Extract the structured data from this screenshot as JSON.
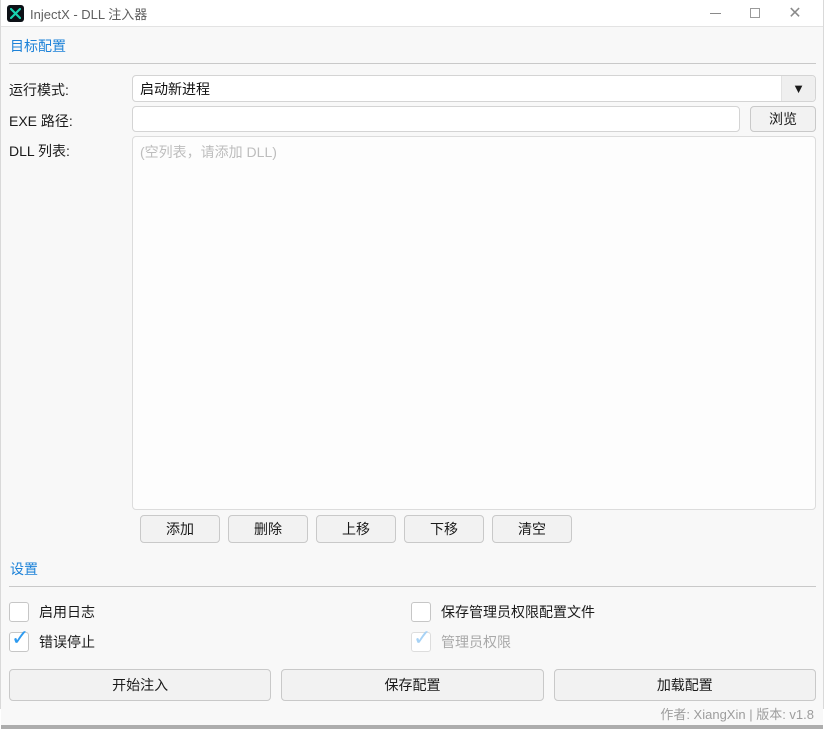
{
  "window": {
    "title": "InjectX - DLL 注入器",
    "icon": "injectx-logo-x",
    "accent_blue": "#1d82d8",
    "check_blue": "#2e9bf0"
  },
  "sections": {
    "target": {
      "title": "目标配置"
    },
    "settings": {
      "title": "设置"
    }
  },
  "form": {
    "run_mode": {
      "label": "运行模式:",
      "value": "启动新进程",
      "arrow_icon": "▼"
    },
    "exe_path": {
      "label": "EXE 路径:",
      "value": "",
      "browse_label": "浏览"
    },
    "dll_list": {
      "label": "DLL 列表:",
      "placeholder": "(空列表，请添加 DLL)"
    }
  },
  "list_buttons": [
    {
      "label": "添加"
    },
    {
      "label": "删除"
    },
    {
      "label": "上移"
    },
    {
      "label": "下移"
    },
    {
      "label": "清空"
    }
  ],
  "checkboxes": {
    "enable_log": {
      "label": "启用日志",
      "checked": false,
      "disabled": false
    },
    "save_admin_profile": {
      "label": "保存管理员权限配置文件",
      "checked": false,
      "disabled": false
    },
    "stop_on_error": {
      "label": "错误停止",
      "checked": true,
      "disabled": false
    },
    "admin_rights": {
      "label": "管理员权限",
      "checked": true,
      "disabled": true
    }
  },
  "actions": [
    {
      "label": "开始注入"
    },
    {
      "label": "保存配置"
    },
    {
      "label": "加载配置"
    }
  ],
  "statusbar": {
    "text": "作者: XiangXin | 版本: v1.8"
  }
}
